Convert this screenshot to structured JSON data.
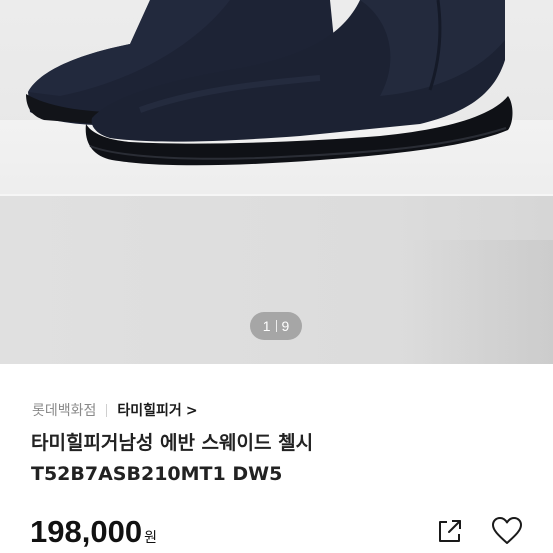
{
  "gallery": {
    "current_index": "1",
    "total_count": "9"
  },
  "product": {
    "store_name": "롯데백화점",
    "brand_name": "타미힐피거",
    "brand_arrow": ">",
    "title_line1": "타미힐피거남성 에반 스웨이드 첼시",
    "title_line2": "T52B7ASB210MT1 DW5",
    "price": "198,000",
    "currency": "원"
  },
  "icons": {
    "share": "share-icon",
    "like": "heart-outline-icon",
    "brand_link": "chevron-right-icon"
  },
  "colors": {
    "boot": "#1c2233",
    "sole": "#111318",
    "background": "#e6e6e6"
  }
}
